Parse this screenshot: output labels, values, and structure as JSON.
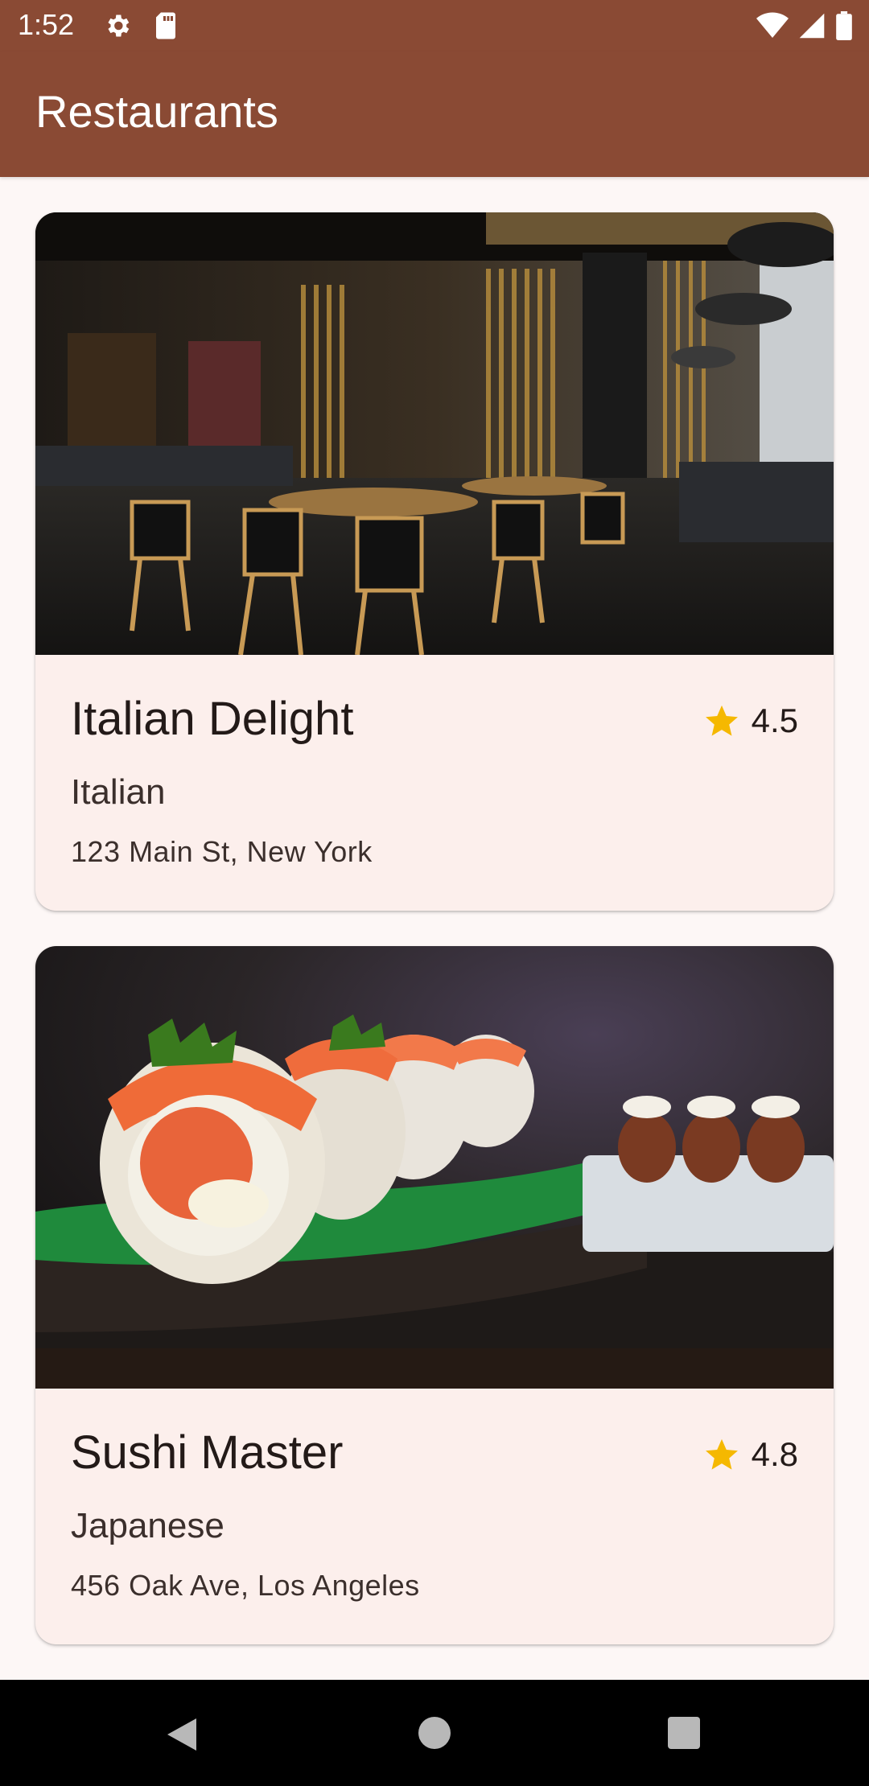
{
  "status_bar": {
    "time": "1:52",
    "left_icons": [
      "settings-icon",
      "sd-card-icon"
    ],
    "right_icons": [
      "wifi-icon",
      "cell-signal-icon",
      "battery-icon"
    ]
  },
  "app_bar": {
    "title": "Restaurants"
  },
  "restaurants": [
    {
      "name": "Italian Delight",
      "rating": "4.5",
      "cuisine": "Italian",
      "address": "123 Main St, New York",
      "image": "restaurant-interior-photo"
    },
    {
      "name": "Sushi Master",
      "rating": "4.8",
      "cuisine": "Japanese",
      "address": "456 Oak Ave, Los Angeles",
      "image": "sushi-rolls-photo"
    }
  ],
  "colors": {
    "primary": "#8a4a34",
    "card_background": "#fcefec",
    "page_background": "#fdf7f6",
    "star": "#f5b800",
    "navigation_bar": "#000000"
  },
  "nav_bar": {
    "buttons": [
      "back-icon",
      "home-icon",
      "recents-icon"
    ]
  }
}
